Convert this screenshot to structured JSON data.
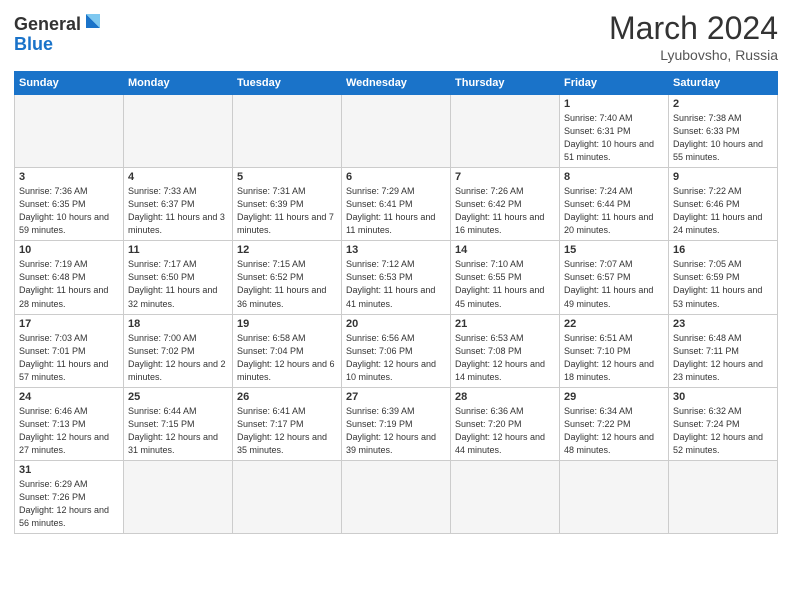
{
  "header": {
    "logo_general": "General",
    "logo_blue": "Blue",
    "month_title": "March 2024",
    "location": "Lyubovsho, Russia"
  },
  "days_of_week": [
    "Sunday",
    "Monday",
    "Tuesday",
    "Wednesday",
    "Thursday",
    "Friday",
    "Saturday"
  ],
  "weeks": [
    [
      {
        "day": "",
        "info": "",
        "empty": true
      },
      {
        "day": "",
        "info": "",
        "empty": true
      },
      {
        "day": "",
        "info": "",
        "empty": true
      },
      {
        "day": "",
        "info": "",
        "empty": true
      },
      {
        "day": "",
        "info": "",
        "empty": true
      },
      {
        "day": "1",
        "info": "Sunrise: 7:40 AM\nSunset: 6:31 PM\nDaylight: 10 hours\nand 51 minutes."
      },
      {
        "day": "2",
        "info": "Sunrise: 7:38 AM\nSunset: 6:33 PM\nDaylight: 10 hours\nand 55 minutes."
      }
    ],
    [
      {
        "day": "3",
        "info": "Sunrise: 7:36 AM\nSunset: 6:35 PM\nDaylight: 10 hours\nand 59 minutes."
      },
      {
        "day": "4",
        "info": "Sunrise: 7:33 AM\nSunset: 6:37 PM\nDaylight: 11 hours\nand 3 minutes."
      },
      {
        "day": "5",
        "info": "Sunrise: 7:31 AM\nSunset: 6:39 PM\nDaylight: 11 hours\nand 7 minutes."
      },
      {
        "day": "6",
        "info": "Sunrise: 7:29 AM\nSunset: 6:41 PM\nDaylight: 11 hours\nand 11 minutes."
      },
      {
        "day": "7",
        "info": "Sunrise: 7:26 AM\nSunset: 6:42 PM\nDaylight: 11 hours\nand 16 minutes."
      },
      {
        "day": "8",
        "info": "Sunrise: 7:24 AM\nSunset: 6:44 PM\nDaylight: 11 hours\nand 20 minutes."
      },
      {
        "day": "9",
        "info": "Sunrise: 7:22 AM\nSunset: 6:46 PM\nDaylight: 11 hours\nand 24 minutes."
      }
    ],
    [
      {
        "day": "10",
        "info": "Sunrise: 7:19 AM\nSunset: 6:48 PM\nDaylight: 11 hours\nand 28 minutes."
      },
      {
        "day": "11",
        "info": "Sunrise: 7:17 AM\nSunset: 6:50 PM\nDaylight: 11 hours\nand 32 minutes."
      },
      {
        "day": "12",
        "info": "Sunrise: 7:15 AM\nSunset: 6:52 PM\nDaylight: 11 hours\nand 36 minutes."
      },
      {
        "day": "13",
        "info": "Sunrise: 7:12 AM\nSunset: 6:53 PM\nDaylight: 11 hours\nand 41 minutes."
      },
      {
        "day": "14",
        "info": "Sunrise: 7:10 AM\nSunset: 6:55 PM\nDaylight: 11 hours\nand 45 minutes."
      },
      {
        "day": "15",
        "info": "Sunrise: 7:07 AM\nSunset: 6:57 PM\nDaylight: 11 hours\nand 49 minutes."
      },
      {
        "day": "16",
        "info": "Sunrise: 7:05 AM\nSunset: 6:59 PM\nDaylight: 11 hours\nand 53 minutes."
      }
    ],
    [
      {
        "day": "17",
        "info": "Sunrise: 7:03 AM\nSunset: 7:01 PM\nDaylight: 11 hours\nand 57 minutes."
      },
      {
        "day": "18",
        "info": "Sunrise: 7:00 AM\nSunset: 7:02 PM\nDaylight: 12 hours\nand 2 minutes."
      },
      {
        "day": "19",
        "info": "Sunrise: 6:58 AM\nSunset: 7:04 PM\nDaylight: 12 hours\nand 6 minutes."
      },
      {
        "day": "20",
        "info": "Sunrise: 6:56 AM\nSunset: 7:06 PM\nDaylight: 12 hours\nand 10 minutes."
      },
      {
        "day": "21",
        "info": "Sunrise: 6:53 AM\nSunset: 7:08 PM\nDaylight: 12 hours\nand 14 minutes."
      },
      {
        "day": "22",
        "info": "Sunrise: 6:51 AM\nSunset: 7:10 PM\nDaylight: 12 hours\nand 18 minutes."
      },
      {
        "day": "23",
        "info": "Sunrise: 6:48 AM\nSunset: 7:11 PM\nDaylight: 12 hours\nand 23 minutes."
      }
    ],
    [
      {
        "day": "24",
        "info": "Sunrise: 6:46 AM\nSunset: 7:13 PM\nDaylight: 12 hours\nand 27 minutes."
      },
      {
        "day": "25",
        "info": "Sunrise: 6:44 AM\nSunset: 7:15 PM\nDaylight: 12 hours\nand 31 minutes."
      },
      {
        "day": "26",
        "info": "Sunrise: 6:41 AM\nSunset: 7:17 PM\nDaylight: 12 hours\nand 35 minutes."
      },
      {
        "day": "27",
        "info": "Sunrise: 6:39 AM\nSunset: 7:19 PM\nDaylight: 12 hours\nand 39 minutes."
      },
      {
        "day": "28",
        "info": "Sunrise: 6:36 AM\nSunset: 7:20 PM\nDaylight: 12 hours\nand 44 minutes."
      },
      {
        "day": "29",
        "info": "Sunrise: 6:34 AM\nSunset: 7:22 PM\nDaylight: 12 hours\nand 48 minutes."
      },
      {
        "day": "30",
        "info": "Sunrise: 6:32 AM\nSunset: 7:24 PM\nDaylight: 12 hours\nand 52 minutes."
      }
    ],
    [
      {
        "day": "31",
        "info": "Sunrise: 6:29 AM\nSunset: 7:26 PM\nDaylight: 12 hours\nand 56 minutes."
      },
      {
        "day": "",
        "info": "",
        "empty": true
      },
      {
        "day": "",
        "info": "",
        "empty": true
      },
      {
        "day": "",
        "info": "",
        "empty": true
      },
      {
        "day": "",
        "info": "",
        "empty": true
      },
      {
        "day": "",
        "info": "",
        "empty": true
      },
      {
        "day": "",
        "info": "",
        "empty": true
      }
    ]
  ]
}
